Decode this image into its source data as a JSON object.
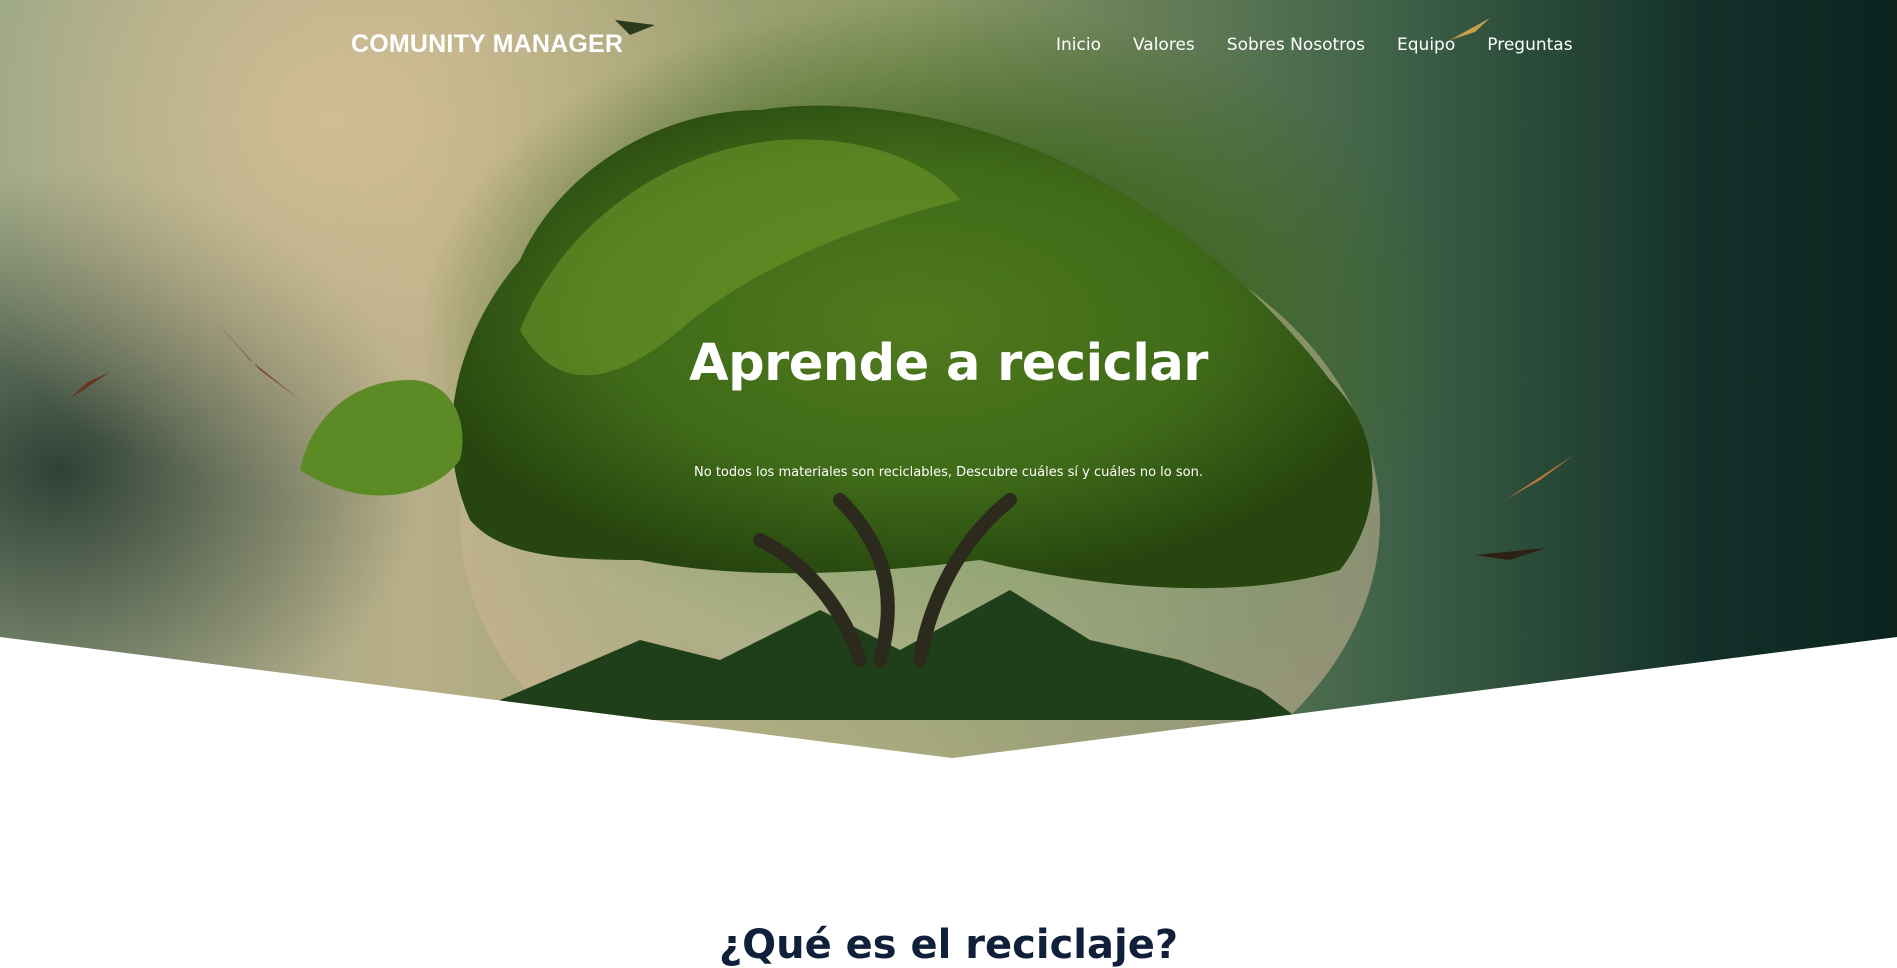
{
  "header": {
    "logo": "COMUNITY MANAGER",
    "nav": [
      {
        "label": "Inicio"
      },
      {
        "label": "Valores"
      },
      {
        "label": "Sobres Nosotros"
      },
      {
        "label": "Equipo"
      },
      {
        "label": "Preguntas"
      }
    ]
  },
  "hero": {
    "title": "Aprende a reciclar",
    "subtitle": "No todos los materiales son reciclables, Descubre cuáles sí y cuáles no lo son.",
    "image_subject": "tree-globe-image"
  },
  "next_section": {
    "heading": "¿Qué es el reciclaje?"
  }
}
